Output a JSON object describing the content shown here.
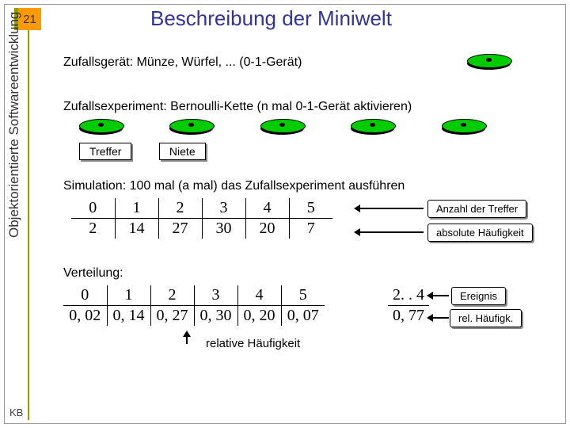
{
  "slide_number": "21",
  "title": "Beschreibung der Miniwelt",
  "side_label": "Objektorientierte Softwareentwicklung",
  "footer": "KB",
  "line_device": "Zufallsgerät: Münze, Würfel, ... (0-1-Gerät)",
  "line_experiment": "Zufallsexperiment: Bernoulli-Kette (n mal 0-1-Gerät aktivieren)",
  "label_hit": "Treffer",
  "label_miss": "Niete",
  "line_simulation": "Simulation: 100 mal (a mal) das Zufallsexperiment ausführen",
  "table_counts": {
    "header": [
      "0",
      "1",
      "2",
      "3",
      "4",
      "5"
    ],
    "values": [
      "2",
      "14",
      "27",
      "30",
      "20",
      "7"
    ]
  },
  "legend_count_header": "Anzahl der Treffer",
  "legend_count_values": "absolute Häufigkeit",
  "line_distribution": "Verteilung:",
  "table_dist": {
    "header": [
      "0",
      "1",
      "2",
      "3",
      "4",
      "5"
    ],
    "values": [
      "0, 02",
      "0, 14",
      "0, 27",
      "0, 30",
      "0, 20",
      "0, 07"
    ]
  },
  "table_event": {
    "header": "2. . 4",
    "value": "0, 77"
  },
  "legend_event": "Ereignis",
  "legend_relfreq": "rel. Häufigk.",
  "label_relfreq_bottom": "relative Häufigkeit"
}
